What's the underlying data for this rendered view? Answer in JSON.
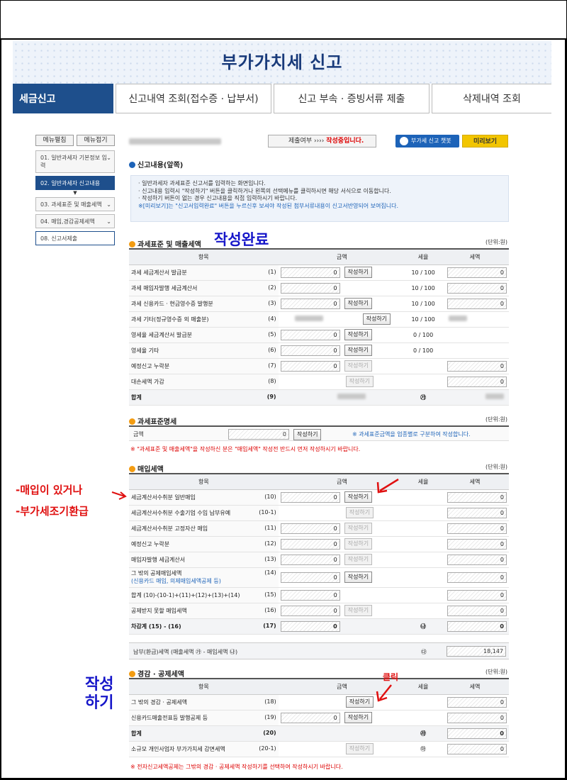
{
  "banner_title": "부가가치세 신고",
  "tabs": [
    "세금신고",
    "신고내역 조회(접수증 · 납부서)",
    "신고 부속 · 증빙서류 제출",
    "삭제내역 조회"
  ],
  "side": {
    "expand": "메뉴펼침",
    "collapse": "메뉴접기",
    "items": [
      "01. 일반과세자 기본정보 입력",
      "02. 일반과세자 신고내용",
      "03. 과세표준 및 매출세액",
      "04. 매입,경감공제세액",
      "08. 신고서제출"
    ]
  },
  "topbar": {
    "status_prefix": "제출여부  ›››› ",
    "status_value": "작성중입니다.",
    "chatbot": "부가세 신고 챗봇",
    "preview": "미리보기"
  },
  "notice": {
    "heading": "신고내용(앞쪽)",
    "lines": [
      "· 일반과세자 과세표준 신고서를 입력하는 화면입니다.",
      "· 신고내용 입력시 \"작성하기\" 버튼을 클릭하거나 왼쪽의 선택메뉴를 클릭하시면 해당 서식으로 이동합니다.",
      "· 작성하기 버튼이 없는 경우 신고내용을 직접 입력하시기 바랍니다.",
      "※[미리보기]는 \"신고서입력완료\" 버튼을 누르신후 보셔야 작성된 첨부서류내용이 신고서반영되어 보여집니다."
    ]
  },
  "unit_label": "(단위:원)",
  "write_btn": "작성하기",
  "sales": {
    "heading": "과세표준 및 매출세액",
    "cols": [
      "항목",
      "금액",
      "세율",
      "세액"
    ],
    "rows": [
      {
        "label": "과세 세금계산서 발급분",
        "no": "(1)",
        "amount": "0",
        "rate": "10 / 100",
        "tax": "0"
      },
      {
        "label": "과세 매입자발행 세금계산서",
        "no": "(2)",
        "amount": "0",
        "rate": "10 / 100",
        "tax": "0"
      },
      {
        "label": "과세 신용카드 · 현금영수증 발행분",
        "no": "(3)",
        "amount": "0",
        "rate": "10 / 100",
        "tax": "0"
      },
      {
        "label": "과세 기타(정규영수증 외 매출분)",
        "no": "(4)",
        "amount": "",
        "rate": "10 / 100",
        "tax": ""
      },
      {
        "label": "영세율 세금계산서 발급분",
        "no": "(5)",
        "amount": "0",
        "rate": "0 / 100",
        "tax": ""
      },
      {
        "label": "영세율 기타",
        "no": "(6)",
        "amount": "0",
        "rate": "0 / 100",
        "tax": ""
      },
      {
        "label": "예정신고 누락분",
        "no": "(7)",
        "amount": "0",
        "rate": "",
        "tax": "0"
      },
      {
        "label": "대손세액 가감",
        "no": "(8)",
        "amount": "",
        "rate": "",
        "tax": "0"
      },
      {
        "label": "합계",
        "no": "(9)",
        "amount": "",
        "rate": "㉮",
        "tax": ""
      }
    ]
  },
  "taxbase": {
    "heading": "과세표준명세",
    "label": "금액",
    "amount": "0",
    "note": "※ 과세표준금액을 업종별로 구분하여 작성합니다.",
    "warn": "※ \"과세표준 및 매출세액\"을 작성하신 분은 \"매입세액\" 작성전 반드시 먼저 작성하시기 바랍니다."
  },
  "purchase": {
    "heading": "매입세액",
    "cols": [
      "항목",
      "금액",
      "세율",
      "세액"
    ],
    "rows": [
      {
        "label": "세금계산서수취분 일반매입",
        "no": "(10)",
        "amount": "0",
        "tax": "0"
      },
      {
        "label": "세금계산서수취분 수출기업 수입 납부유예",
        "no": "(10-1)",
        "amount": "",
        "tax": "0"
      },
      {
        "label": "세금계산서수취분 고정자산 매입",
        "no": "(11)",
        "amount": "0",
        "tax": "0"
      },
      {
        "label": "예정신고 누락분",
        "no": "(12)",
        "amount": "0",
        "tax": "0"
      },
      {
        "label": "매입자발행 세금계산서",
        "no": "(13)",
        "amount": "0",
        "tax": "0"
      },
      {
        "label": "그 밖의 공제매입세액",
        "sub": "(신용카드 매입, 의제매입세액공제 등)",
        "no": "(14)",
        "amount": "0",
        "tax": "0"
      },
      {
        "label": "합계 (10)-(10-1)+(11)+(12)+(13)+(14)",
        "no": "(15)",
        "amount": "0",
        "tax": "0"
      },
      {
        "label": "공제받지 못할 매입세액",
        "no": "(16)",
        "amount": "0",
        "tax": "0"
      },
      {
        "label": "차감계 (15) - (16)",
        "no": "(17)",
        "amount": "0",
        "rate": "㉯",
        "tax": "0"
      }
    ],
    "net_label": "납부(환급)세액 (매출세액 ㉮ - 매입세액 ㉯)",
    "net_mark": "㉰",
    "net_value": "18,147"
  },
  "reduction": {
    "heading": "경감 · 공제세액",
    "cols": [
      "항목",
      "금액",
      "세율",
      "세액"
    ],
    "rows": [
      {
        "label": "그 밖의 경감 · 공제세액",
        "no": "(18)",
        "tax": "0"
      },
      {
        "label": "신용카드매출전표등 발행공제 등",
        "no": "(19)",
        "amount": "0",
        "tax": "0"
      },
      {
        "label": "합계",
        "no": "(20)",
        "rate": "㉱",
        "tax": "0"
      },
      {
        "label": "소규모 개인사업자 부가가치세 감면세액",
        "no": "(20-1)",
        "rate": "㉲",
        "tax": "0"
      }
    ],
    "warn": "※ 전자신고세액공제는 그밖의 경감 · 공제세액 작성하기를 선택하여 작성하시기 바랍니다."
  },
  "annotations": {
    "done": "작성완료",
    "purchase_line1": "-매입이 있거나",
    "purchase_line2": "-부가세조기환급",
    "click": "클릭",
    "write": "작성하기",
    "write_line1": "작성",
    "write_line2": "하기"
  }
}
